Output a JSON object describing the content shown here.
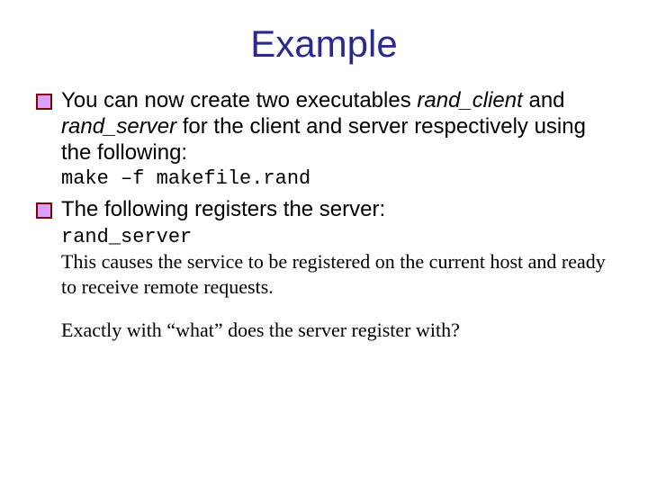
{
  "title": "Example",
  "bullets": [
    {
      "lead": "You can now create two executables ",
      "em1": "rand_client",
      "mid": " and ",
      "em2": "rand_server",
      "tail": " for the client and server respectively using the following:",
      "code": "make –f makefile.rand"
    },
    {
      "text": "The following registers the server:",
      "sub_code": "rand_server",
      "sub_text": "This causes the service to be registered on the current host and ready to receive remote requests.",
      "question": "Exactly with “what” does the server register with?"
    }
  ]
}
